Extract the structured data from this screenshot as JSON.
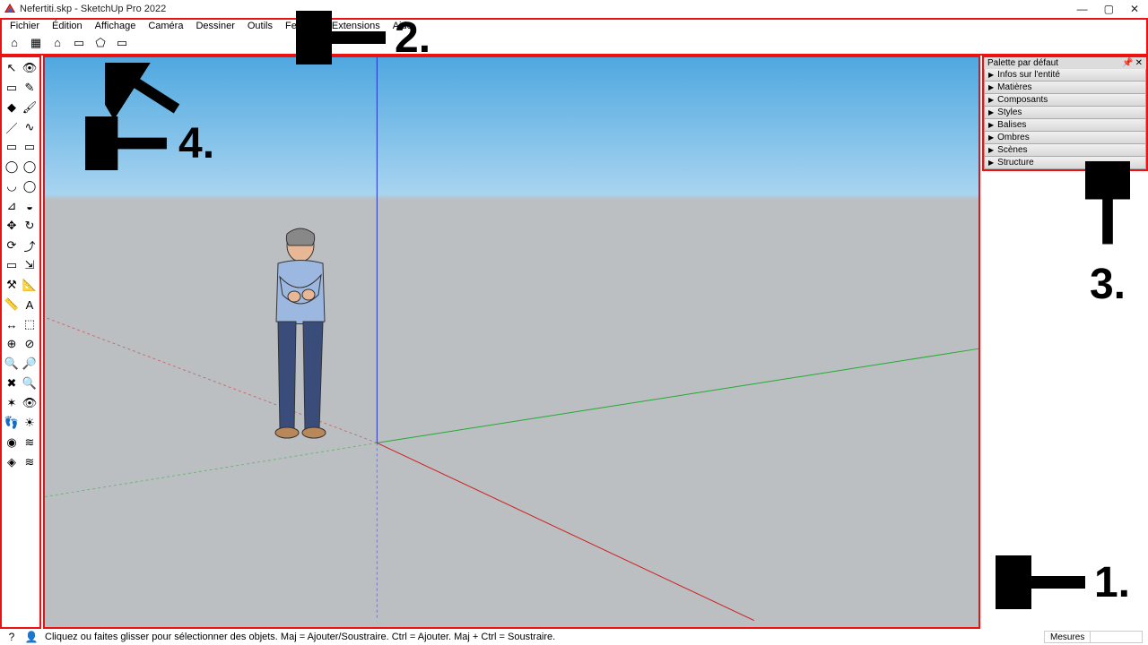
{
  "window": {
    "title": "Nefertiti.skp - SketchUp Pro 2022",
    "min": "—",
    "max": "▢",
    "close": "✕"
  },
  "menu": [
    "Fichier",
    "Édition",
    "Affichage",
    "Caméra",
    "Dessiner",
    "Outils",
    "Fenêtre",
    "Extensions",
    "Aide"
  ],
  "topToolbar": [
    "⌂",
    "▦",
    "⌂",
    "▭",
    "⬠",
    "▭"
  ],
  "sideTools": [
    "↖",
    "👁",
    "▭",
    "✎",
    "◆",
    "🖌",
    "／",
    "∿",
    "▭",
    "▭",
    "◯",
    "◯",
    "◡",
    "◯",
    "⊿",
    "◒",
    "✥",
    "↻",
    "⟳",
    "⤴",
    "▭",
    "⇲",
    "⚒",
    "📐",
    "📏",
    "A",
    "↔",
    "⬚",
    "⊕",
    "⊘",
    "🔍",
    "🔎",
    "✖",
    "🔍",
    "✶",
    "👁",
    "👣",
    "☀",
    "◉",
    "≋",
    "◈",
    "≋"
  ],
  "tray": {
    "title": "Palette par défaut",
    "sections": [
      "Infos sur l'entité",
      "Matières",
      "Composants",
      "Styles",
      "Balises",
      "Ombres",
      "Scènes",
      "Structure"
    ]
  },
  "status": {
    "hint": "Cliquez ou faites glisser pour sélectionner des objets. Maj = Ajouter/Soustraire. Ctrl = Ajouter. Maj + Ctrl = Soustraire.",
    "measureLabel": "Mesures"
  },
  "annotations": {
    "n1": "1.",
    "n2": "2.",
    "n3": "3.",
    "n4": "4."
  }
}
